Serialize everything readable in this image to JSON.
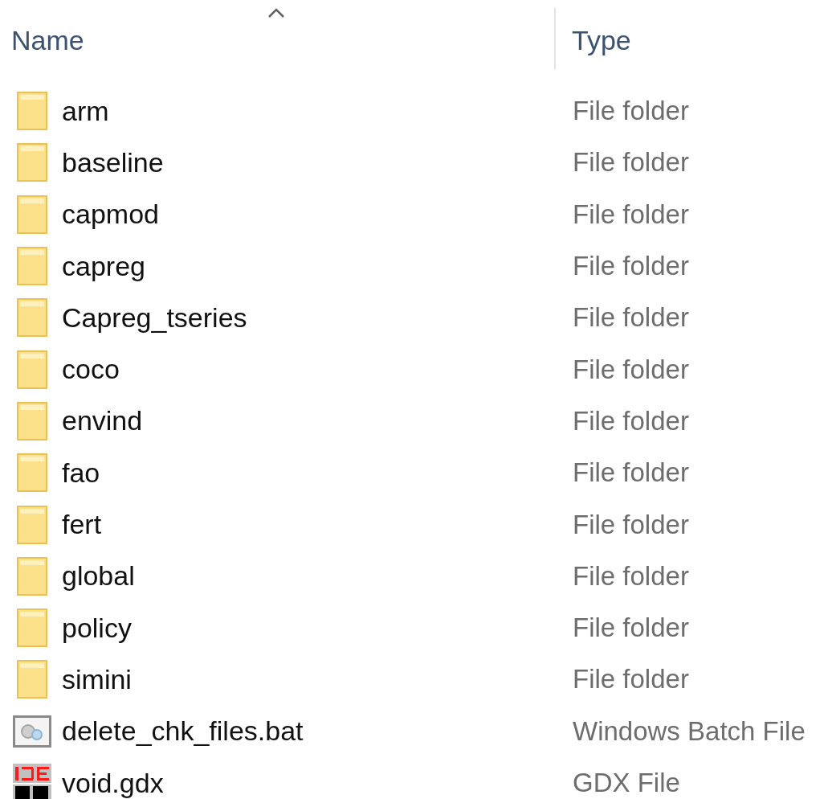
{
  "columns": [
    {
      "label": "Name",
      "sorted": true
    },
    {
      "label": "Type",
      "sorted": false
    }
  ],
  "files": [
    {
      "name": "arm",
      "type": "File folder",
      "kind": "folder"
    },
    {
      "name": "baseline",
      "type": "File folder",
      "kind": "folder"
    },
    {
      "name": "capmod",
      "type": "File folder",
      "kind": "folder"
    },
    {
      "name": "capreg",
      "type": "File folder",
      "kind": "folder"
    },
    {
      "name": "Capreg_tseries",
      "type": "File folder",
      "kind": "folder"
    },
    {
      "name": "coco",
      "type": "File folder",
      "kind": "folder"
    },
    {
      "name": "envind",
      "type": "File folder",
      "kind": "folder"
    },
    {
      "name": "fao",
      "type": "File folder",
      "kind": "folder"
    },
    {
      "name": "fert",
      "type": "File folder",
      "kind": "folder"
    },
    {
      "name": "global",
      "type": "File folder",
      "kind": "folder"
    },
    {
      "name": "policy",
      "type": "File folder",
      "kind": "folder"
    },
    {
      "name": "simini",
      "type": "File folder",
      "kind": "folder"
    },
    {
      "name": "delete_chk_files.bat",
      "type": "Windows Batch File",
      "kind": "batch"
    },
    {
      "name": "void.gdx",
      "type": "GDX File",
      "kind": "gdx"
    }
  ]
}
